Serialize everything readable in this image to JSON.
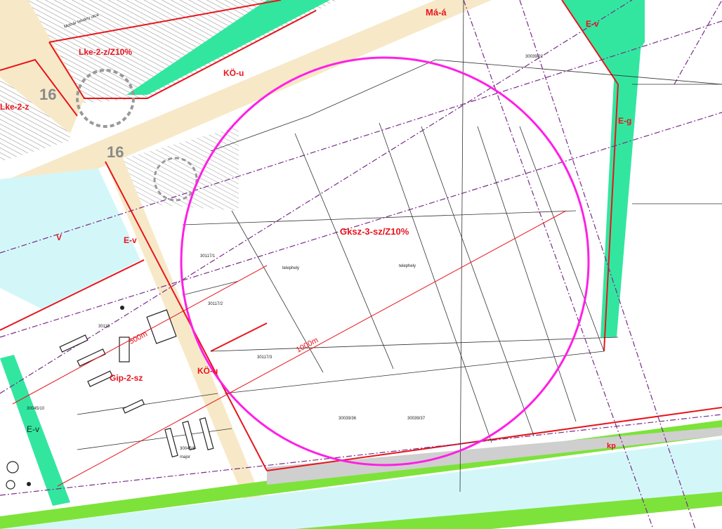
{
  "map": {
    "zones": {
      "gksz": "Gksz-3-sz/Z10%",
      "lke_top": "Lke-2-z/Z10%",
      "lke_left": "Lke-2-z",
      "ko_u_top": "KÖ-u",
      "ko_u_mid": "KÖ-u",
      "ma_a": "Má-á",
      "e_v_topright": "E-v",
      "e_g": "E-g",
      "e_v_mid": "E-v",
      "e_v_left": "E-v",
      "v": "V",
      "gip": "Gip-2-sz",
      "kp": "kp"
    },
    "measurements": {
      "d500": "500m",
      "d1000": "1000m"
    },
    "road_numbers": {
      "top": "16",
      "mid": "16"
    },
    "small_text": {
      "telephely1": "telephely",
      "telephely2": "telephely",
      "p30117_1": "30117/1",
      "p30117_2": "30117/2",
      "p30117_3": "30117/3",
      "p30039_22": "30039/22",
      "p30039_37": "30039/37",
      "p30039_36": "30039/36",
      "p30045_10": "30045/10",
      "p30045_8": "30045/8",
      "p30115": "30115",
      "major": "major",
      "street": "Molnár Istvány utca"
    },
    "colors": {
      "zone_border": "#e8141c",
      "protection_circle": "#ff1fe6",
      "green_strip": "#33e6a0",
      "lime_strip": "#7de33a",
      "water": "#d3f7f9",
      "road": "#f7e9c8",
      "railway": "#7a2c8a"
    }
  }
}
